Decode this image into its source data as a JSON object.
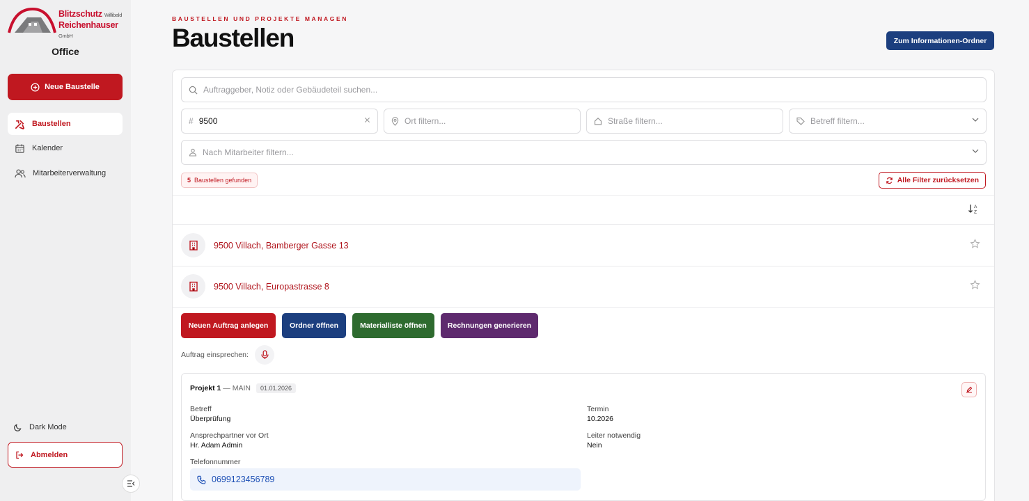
{
  "sidebar": {
    "logo": {
      "line1": "Blitzschutz",
      "line1_small": "Willibald",
      "line2": "Reichenhauser",
      "line2_small": "GmbH"
    },
    "section_title": "Office",
    "new_button": "Neue Baustelle",
    "nav": [
      {
        "label": "Baustellen",
        "icon": "tools-icon",
        "active": true
      },
      {
        "label": "Kalender",
        "icon": "calendar-icon",
        "active": false
      },
      {
        "label": "Mitarbeiterverwaltung",
        "icon": "users-icon",
        "active": false
      }
    ],
    "dark_mode": "Dark Mode",
    "logout": "Abmelden"
  },
  "header": {
    "eyebrow": "BAUSTELLEN UND PROJEKTE MANAGEN",
    "title": "Baustellen",
    "info_button": "Zum Informationen-Ordner"
  },
  "filters": {
    "search_placeholder": "Auftraggeber, Notiz oder Gebäudeteil suchen...",
    "number_value": "9500",
    "ort_placeholder": "Ort filtern...",
    "strasse_placeholder": "Straße filtern...",
    "betreff_placeholder": "Betreff filtern...",
    "mitarbeiter_placeholder": "Nach Mitarbeiter filtern..."
  },
  "results": {
    "count": "5",
    "count_label": "Baustellen gefunden",
    "reset_button": "Alle Filter zurücksetzen"
  },
  "sites": [
    {
      "title": "9500 Villach, Bamberger Gasse 13"
    },
    {
      "title": "9500 Villach, Europastrasse 8"
    }
  ],
  "actions": {
    "new_order": "Neuen Auftrag anlegen",
    "open_folder": "Ordner öffnen",
    "material_list": "Materialliste öffnen",
    "invoices": "Rechnungen generieren",
    "dictate_label": "Auftrag einsprechen:"
  },
  "project": {
    "name": "Projekt 1",
    "separator": "—",
    "type": "MAIN",
    "date": "01.01.2026",
    "betreff_label": "Betreff",
    "betreff_value": "Überprüfung",
    "termin_label": "Termin",
    "termin_value": "10.2026",
    "contact_label": "Ansprechpartner vor Ort",
    "contact_value": "Hr. Adam Admin",
    "ladder_label": "Leiter notwendig",
    "ladder_value": "Nein",
    "phone_label": "Telefonnummer",
    "phone_value": "0699123456789"
  },
  "colors": {
    "brand_red": "#c01820",
    "navy": "#1c3f7f",
    "green": "#2e6b2f",
    "purple": "#5e2a6e"
  }
}
